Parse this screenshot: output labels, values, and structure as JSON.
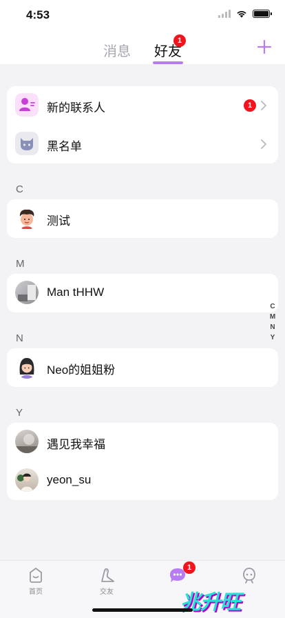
{
  "status_bar": {
    "time": "4:53"
  },
  "header": {
    "tabs": [
      {
        "label": "消息",
        "active": false
      },
      {
        "label": "好友",
        "active": true,
        "badge": "1"
      }
    ],
    "accent_color": "#b77cf2"
  },
  "top_items": [
    {
      "label": "新的联系人",
      "badge": "1",
      "icon": "new-contact-icon"
    },
    {
      "label": "黑名单",
      "icon": "blacklist-icon"
    }
  ],
  "sections": [
    {
      "letter": "C",
      "contacts": [
        {
          "name": "测试"
        }
      ]
    },
    {
      "letter": "M",
      "contacts": [
        {
          "name": "Man tHHW"
        }
      ]
    },
    {
      "letter": "N",
      "contacts": [
        {
          "name": "Neo的姐姐粉"
        }
      ]
    },
    {
      "letter": "Y",
      "contacts": [
        {
          "name": "遇见我幸福"
        },
        {
          "name": "yeon_su"
        }
      ]
    }
  ],
  "side_index": [
    "C",
    "M",
    "N",
    "Y"
  ],
  "bottom_nav": [
    {
      "label": "首页",
      "icon": "home-icon"
    },
    {
      "label": "交友",
      "icon": "dinosaur-icon"
    },
    {
      "label": "",
      "icon": "chat-bubble-icon",
      "badge": "1"
    },
    {
      "label": "",
      "icon": "ghost-icon"
    }
  ],
  "watermark": "兆升旺",
  "badge_color": "#f0141c"
}
